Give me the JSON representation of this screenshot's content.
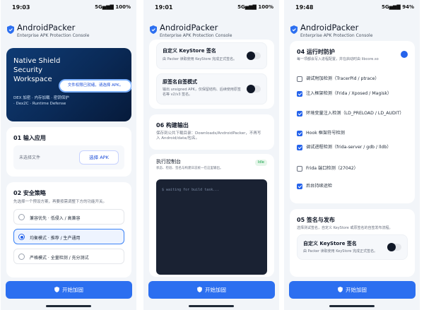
{
  "status": {
    "p1": {
      "time": "19:03",
      "right": "5G▅▆▇ 100%"
    },
    "p2": {
      "time": "19:01",
      "right": "5G▅▆▇ 100%"
    },
    "p3": {
      "time": "19:48",
      "right": "5G▅▆▇ 94%"
    }
  },
  "app": {
    "title": "AndroidPacker",
    "subtitle": "Enterprise APK Protection Console"
  },
  "colors": {
    "accent": "#2c6ff0",
    "hero": "#0a2a57",
    "console": "#1a2233"
  },
  "p1": {
    "hero": {
      "title": "Native Shield Security Workspace",
      "tags": "DEX 加密 · 内存加载 · 密钥保护 · Dex2C · Runtime Defense",
      "badge": "文件权限已就绪，请选择 APK。"
    },
    "input": {
      "title": "01  输入应用",
      "placeholder": "未选择文件",
      "button": "选择 APK"
    },
    "strategy": {
      "title": "02  安全策略",
      "desc": "先选择一个预设方案，再要按需调整下方的功能开关。",
      "options": [
        {
          "label": "兼容优先 · 低侵入 / 高兼容",
          "selected": false
        },
        {
          "label": "均衡模式 · 推荐 / 生产通用",
          "selected": true
        },
        {
          "label": "严格模式 · 全量检测 / 充分测试",
          "selected": false
        }
      ]
    }
  },
  "p2": {
    "custom_ks": {
      "title": "自定义 KeyStore 签名",
      "desc": "由 Packer 读取使用 KeyStore 完成正式签名。"
    },
    "origin_sign": {
      "title": "原签名自签模式",
      "desc": "输出 unsigned APK，仅保留结构、后续使用原签名等 v2/v3 签名。"
    },
    "build_output": {
      "title": "06  构建输出",
      "desc": "保存到公共下载目录：Downloads/AndroidPacker，不再写入 Android/data/包名。"
    },
    "console": {
      "title": "执行控制台",
      "desc": "状态、检验、签名与构建日志统一在这里输出。",
      "badge": "Idle",
      "log": "$ waiting for build task..."
    }
  },
  "p3": {
    "runtime": {
      "title": "04  运行时防护",
      "desc": "每一项都会写入进程配置，并在启动时由 libcore.so",
      "checks": [
        {
          "label": "调试附加检测（TracerPid / ptrace）",
          "checked": false
        },
        {
          "label": "注入框架检测（Frida / Xposed / Magisk）",
          "checked": true
        },
        {
          "label": "环境变量注入检测（LD_PRELOAD / LD_AUDIT）",
          "checked": true
        },
        {
          "label": "Hook 框架符号检测",
          "checked": true
        },
        {
          "label": "调试进程检测（frida-server / gdb / lldb）",
          "checked": true
        },
        {
          "label": "Frida 端口检测（27042）",
          "checked": false
        },
        {
          "label": "后台持续运检",
          "checked": true
        }
      ]
    },
    "sign": {
      "title": "05  签名与发布",
      "desc": "选择测试签名，自定义 KeyStore 或原签名的自签发布流程。"
    },
    "custom_ks": {
      "title": "自定义 KeyStore 签名",
      "desc": "由 Packer 读取使用 KeyStore 完成正式签名。"
    }
  },
  "action": {
    "label": "开始加固"
  }
}
